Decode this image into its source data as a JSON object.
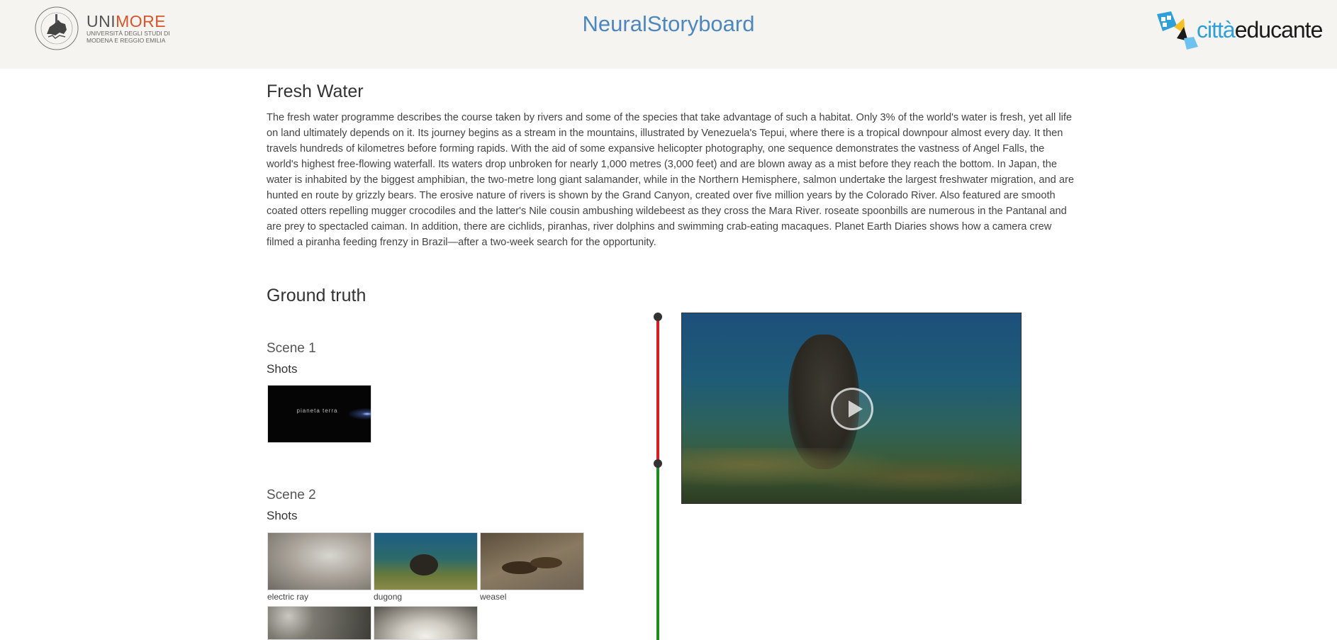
{
  "header": {
    "app_title": "NeuralStoryboard",
    "left_logo": {
      "name_part1": "UNI",
      "name_part2": "MORE",
      "subtitle_line1": "UNIVERSITÀ DEGLI STUDI DI",
      "subtitle_line2": "MODENA E REGGIO EMILIA"
    },
    "right_logo": {
      "part1": "città",
      "part2": "educante"
    }
  },
  "video_info": {
    "title": "Fresh Water",
    "description": "The fresh water programme describes the course taken by rivers and some of the species that take advantage of such a habitat. Only 3% of the world's water is fresh, yet all life on land ultimately depends on it. Its journey begins as a stream in the mountains, illustrated by Venezuela's Tepui, where there is a tropical downpour almost every day. It then travels hundreds of kilometres before forming rapids. With the aid of some expansive helicopter photography, one sequence demonstrates the vastness of Angel Falls, the world's highest free-flowing waterfall. Its waters drop unbroken for nearly 1,000 metres (3,000 feet) and are blown away as a mist before they reach the bottom. In Japan, the water is inhabited by the biggest amphibian, the two-metre long giant salamander, while in the Northern Hemisphere, salmon undertake the largest freshwater migration, and are hunted en route by grizzly bears. The erosive nature of rivers is shown by the Grand Canyon, created over five million years by the Colorado River. Also featured are smooth coated otters repelling mugger crocodiles and the latter's Nile cousin ambushing wildebeest as they cross the Mara River. roseate spoonbills are numerous in the Pantanal and are prey to spectacled caiman. In addition, there are cichlids, piranhas, river dolphins and swimming crab-eating macaques. Planet Earth Diaries shows how a camera crew filmed a piranha feeding frenzy in Brazil—after a two-week search for the opportunity."
  },
  "ground_truth": {
    "title": "Ground truth",
    "scenes": [
      {
        "title": "Scene 1",
        "shots_label": "Shots",
        "shots": [
          {
            "thumb_text": "pianeta terra",
            "label": ""
          }
        ]
      },
      {
        "title": "Scene 2",
        "shots_label": "Shots",
        "shots": [
          {
            "label": "electric ray"
          },
          {
            "label": "dugong"
          },
          {
            "label": "weasel"
          },
          {
            "label": ""
          },
          {
            "label": ""
          }
        ]
      }
    ]
  },
  "colors": {
    "header_bg": "#f5f4f0",
    "title_blue": "#4d87bf",
    "timeline_red": "#d21f1f",
    "timeline_green": "#1e8c1e",
    "unimore_accent": "#d9532b"
  },
  "icons": {
    "play": "play-icon"
  }
}
